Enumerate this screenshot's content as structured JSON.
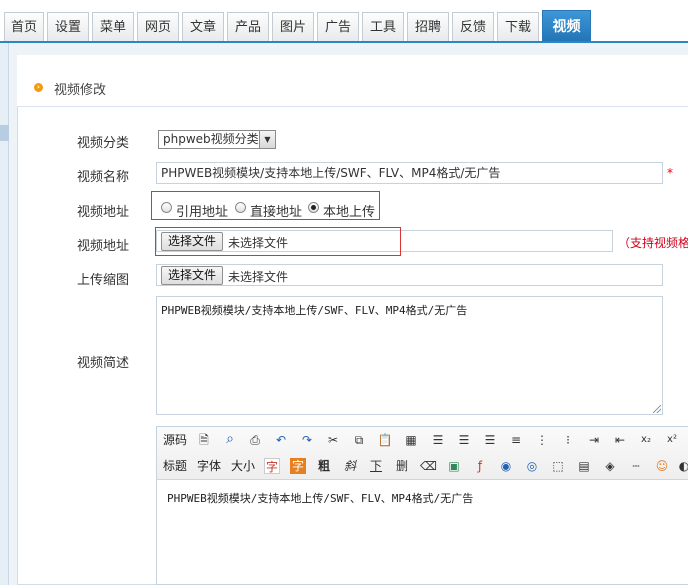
{
  "nav": {
    "tabs": [
      {
        "label": "首页"
      },
      {
        "label": "设置"
      },
      {
        "label": "菜单"
      },
      {
        "label": "网页"
      },
      {
        "label": "文章"
      },
      {
        "label": "产品"
      },
      {
        "label": "图片"
      },
      {
        "label": "广告"
      },
      {
        "label": "工具"
      },
      {
        "label": "招聘"
      },
      {
        "label": "反馈"
      },
      {
        "label": "下载"
      },
      {
        "label": "视频"
      }
    ],
    "active_tab": "视频",
    "accent_color": "#2a86c5"
  },
  "page": {
    "title": "视频修改"
  },
  "form": {
    "category": {
      "label": "视频分类",
      "value": "phpweb视频分类"
    },
    "name": {
      "label": "视频名称",
      "value": "PHPWEB视频模块/支持本地上传/SWF、FLV、MP4格式/无广告",
      "required_mark": "*"
    },
    "source": {
      "label": "视频地址",
      "options": [
        {
          "label": "引用地址",
          "selected": false
        },
        {
          "label": "直接地址",
          "selected": false
        },
        {
          "label": "本地上传",
          "selected": true
        }
      ]
    },
    "file": {
      "label": "视频地址",
      "button": "选择文件",
      "status": "未选择文件",
      "hint": "（支持视频格式"
    },
    "thumbnail": {
      "label": "上传缩图",
      "button": "选择文件",
      "status": "未选择文件"
    },
    "summary": {
      "label": "视频简述",
      "value": "PHPWEB视频模块/支持本地上传/SWF、FLV、MP4格式/无广告"
    }
  },
  "editor": {
    "toolbar_row1": {
      "source": "源码",
      "icons": [
        "preview-icon",
        "find-icon",
        "print-icon",
        "undo-icon",
        "redo-icon",
        "cut-icon",
        "copy-icon",
        "paste-icon",
        "select-all-icon",
        "align-left-icon",
        "align-center-icon",
        "align-right-icon",
        "justify-icon",
        "ordered-list-icon",
        "unordered-list-icon",
        "indent-icon",
        "outdent-icon",
        "subscript-icon",
        "superscript-icon"
      ]
    },
    "toolbar_row2": {
      "heading": "标题",
      "font": "字体",
      "size": "大小",
      "text_color": "字",
      "bg_color": "字",
      "bold": "粗",
      "italic": "斜",
      "underline": "下",
      "strike": "删"
    },
    "content": "PHPWEB视频模块/支持本地上传/SWF、FLV、MP4格式/无广告"
  }
}
